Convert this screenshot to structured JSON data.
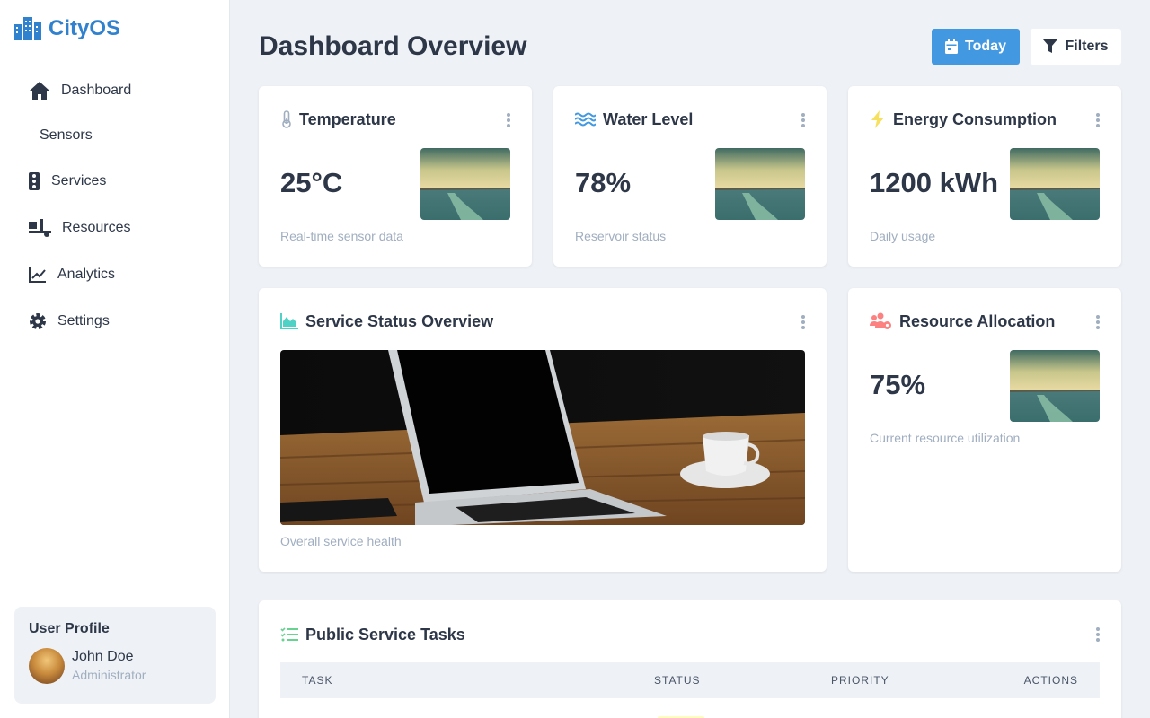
{
  "app": {
    "name": "CityOS"
  },
  "sidebar": {
    "items": [
      {
        "label": "Dashboard",
        "icon": "home-icon"
      },
      {
        "label": "Sensors",
        "icon": ""
      },
      {
        "label": "Services",
        "icon": "traffic-light-icon"
      },
      {
        "label": "Resources",
        "icon": "truck-loading-icon"
      },
      {
        "label": "Analytics",
        "icon": "chart-line-icon"
      },
      {
        "label": "Settings",
        "icon": "gear-icon"
      }
    ],
    "user": {
      "title": "User Profile",
      "name": "John Doe",
      "role": "Administrator"
    }
  },
  "header": {
    "title": "Dashboard Overview",
    "today_label": "Today",
    "filters_label": "Filters"
  },
  "cards": {
    "temperature": {
      "title": "Temperature",
      "value": "25°C",
      "caption": "Real-time sensor data",
      "icon": "thermometer-icon"
    },
    "water": {
      "title": "Water Level",
      "value": "78%",
      "caption": "Reservoir status",
      "icon": "water-icon"
    },
    "energy": {
      "title": "Energy Consumption",
      "value": "1200 kWh",
      "caption": "Daily usage",
      "icon": "bolt-icon"
    },
    "service": {
      "title": "Service Status Overview",
      "caption": "Overall service health",
      "icon": "chart-area-icon"
    },
    "resource": {
      "title": "Resource Allocation",
      "value": "75%",
      "caption": "Current resource utilization",
      "icon": "users-cog-icon"
    }
  },
  "tasks": {
    "title": "Public Service Tasks",
    "icon": "tasks-icon",
    "columns": [
      "TASK",
      "STATUS",
      "PRIORITY",
      "ACTIONS"
    ]
  },
  "colors": {
    "accent": "#4299e1",
    "brand": "#3182ce",
    "water_icon": "#4299e1",
    "energy_icon": "#f6e05e",
    "chart_icon": "#4fd1c5",
    "resource_icon": "#fc8181",
    "tasks_icon": "#68d391"
  }
}
